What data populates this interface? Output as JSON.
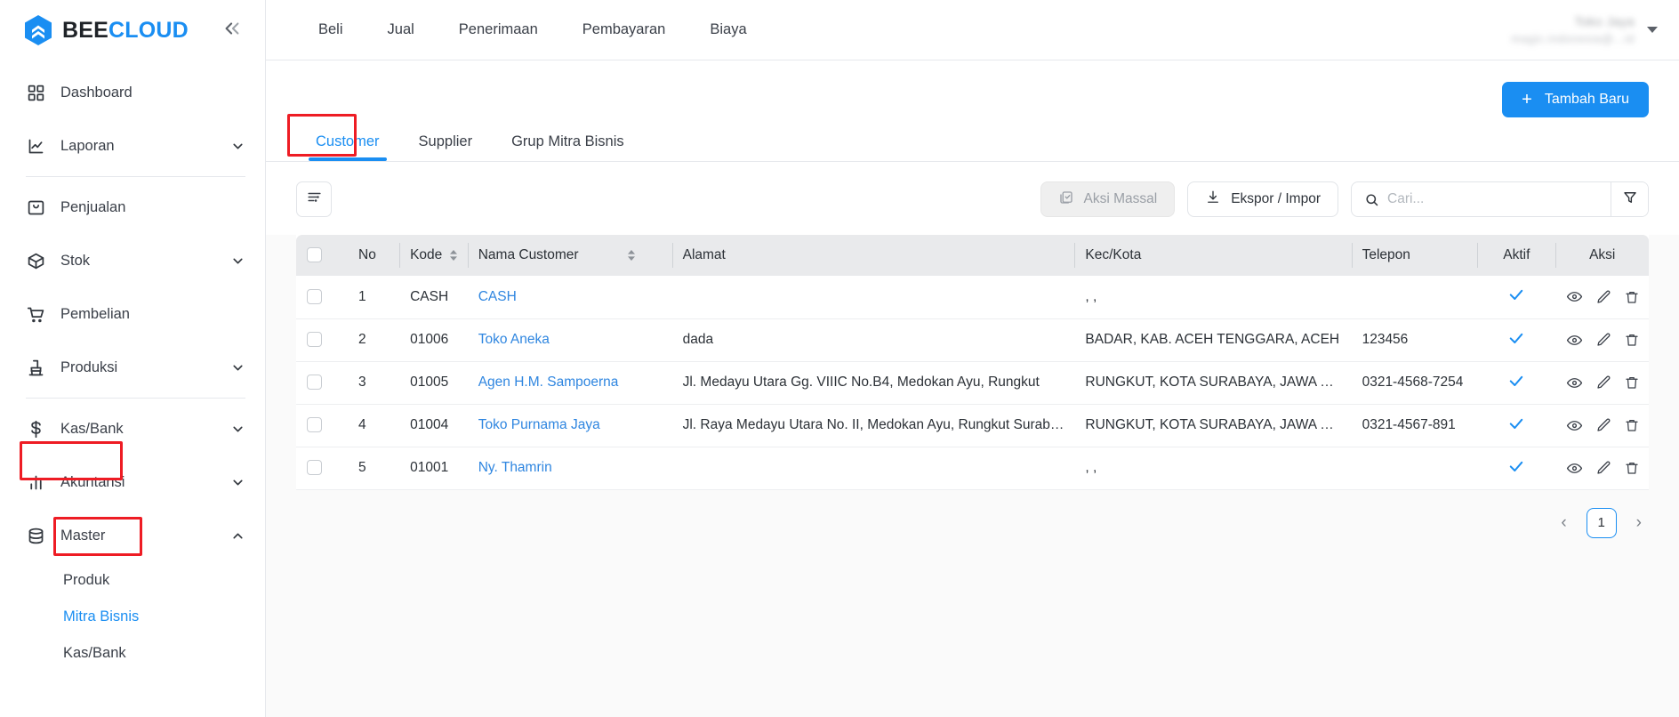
{
  "brand": {
    "part1": "BEE",
    "part2": "CLOUD",
    "collapse_icon": "chevrons-left-icon"
  },
  "sidebar": {
    "items": [
      {
        "label": "Dashboard",
        "icon": "grid-icon",
        "chevron": ""
      },
      {
        "label": "Laporan",
        "icon": "chart-line-icon",
        "chevron": "⌄"
      },
      {
        "label": "Penjualan",
        "icon": "tag-icon",
        "chevron": ""
      },
      {
        "label": "Stok",
        "icon": "box-icon",
        "chevron": "⌄"
      },
      {
        "label": "Pembelian",
        "icon": "cart-icon",
        "chevron": ""
      },
      {
        "label": "Produksi",
        "icon": "factory-icon",
        "chevron": "⌄"
      },
      {
        "label": "Kas/Bank",
        "icon": "dollar-icon",
        "chevron": "⌄"
      },
      {
        "label": "Akuntansi",
        "icon": "bar-chart-icon",
        "chevron": "⌄"
      },
      {
        "label": "Master",
        "icon": "database-icon",
        "chevron": "⌃"
      }
    ],
    "sub_items": [
      {
        "label": "Produk",
        "active": false
      },
      {
        "label": "Mitra Bisnis",
        "active": true
      },
      {
        "label": "Kas/Bank",
        "active": false
      }
    ]
  },
  "topnav": {
    "items": [
      "Beli",
      "Jual",
      "Penerimaan",
      "Pembayaran",
      "Biaya"
    ],
    "user_name": "Toko Jaya",
    "user_email": "magic.indonesia@...id"
  },
  "actions": {
    "add_new_label": "Tambah Baru",
    "add_new_icon": "plus-icon"
  },
  "tabs": [
    {
      "label": "Customer",
      "active": true
    },
    {
      "label": "Supplier",
      "active": false
    },
    {
      "label": "Grup Mitra Bisnis",
      "active": false
    }
  ],
  "toolbar": {
    "column_settings_icon": "sliders-icon",
    "bulk_action_label": "Aksi Massal",
    "bulk_action_icon": "copy-check-icon",
    "export_import_label": "Ekspor / Impor",
    "export_import_icon": "download-icon",
    "search_placeholder": "Cari...",
    "search_value": "",
    "search_icon": "search-icon",
    "filter_icon": "funnel-icon"
  },
  "table": {
    "columns": [
      "No",
      "Kode",
      "Nama Customer",
      "Alamat",
      "Kec/Kota",
      "Telepon",
      "Aktif",
      "Aksi"
    ],
    "rows": [
      {
        "no": "1",
        "kode": "CASH",
        "nama": "CASH",
        "alamat": "",
        "kec": ", ,",
        "telepon": "",
        "aktif": true
      },
      {
        "no": "2",
        "kode": "01006",
        "nama": "Toko Aneka",
        "alamat": "dada",
        "kec": "BADAR, KAB. ACEH TENGGARA, ACEH",
        "telepon": "123456",
        "aktif": true
      },
      {
        "no": "3",
        "kode": "01005",
        "nama": "Agen H.M. Sampoerna",
        "alamat": "Jl. Medayu Utara Gg. VIIIC No.B4, Medokan Ayu, Rungkut",
        "kec": "RUNGKUT, KOTA SURABAYA, JAWA TIMUR",
        "telepon": "0321-4568-7254",
        "aktif": true
      },
      {
        "no": "4",
        "kode": "01004",
        "nama": "Toko Purnama Jaya",
        "alamat": "Jl. Raya Medayu Utara No. II, Medokan Ayu, Rungkut Surabaya",
        "kec": "RUNGKUT, KOTA SURABAYA, JAWA TIMUR",
        "telepon": "0321-4567-891",
        "aktif": true
      },
      {
        "no": "5",
        "kode": "01001",
        "nama": "Ny. Thamrin",
        "alamat": "",
        "kec": ", ,",
        "telepon": "",
        "aktif": true
      }
    ],
    "row_action_icons": [
      "eye-icon",
      "pencil-icon",
      "trash-icon"
    ]
  },
  "pagination": {
    "prev": "‹",
    "current_page": "1",
    "next": "›"
  },
  "colors": {
    "accent": "#1a8ef2",
    "link": "#2f86e0",
    "highlight": "#ee1c24",
    "header_bg": "#e9eaec"
  }
}
